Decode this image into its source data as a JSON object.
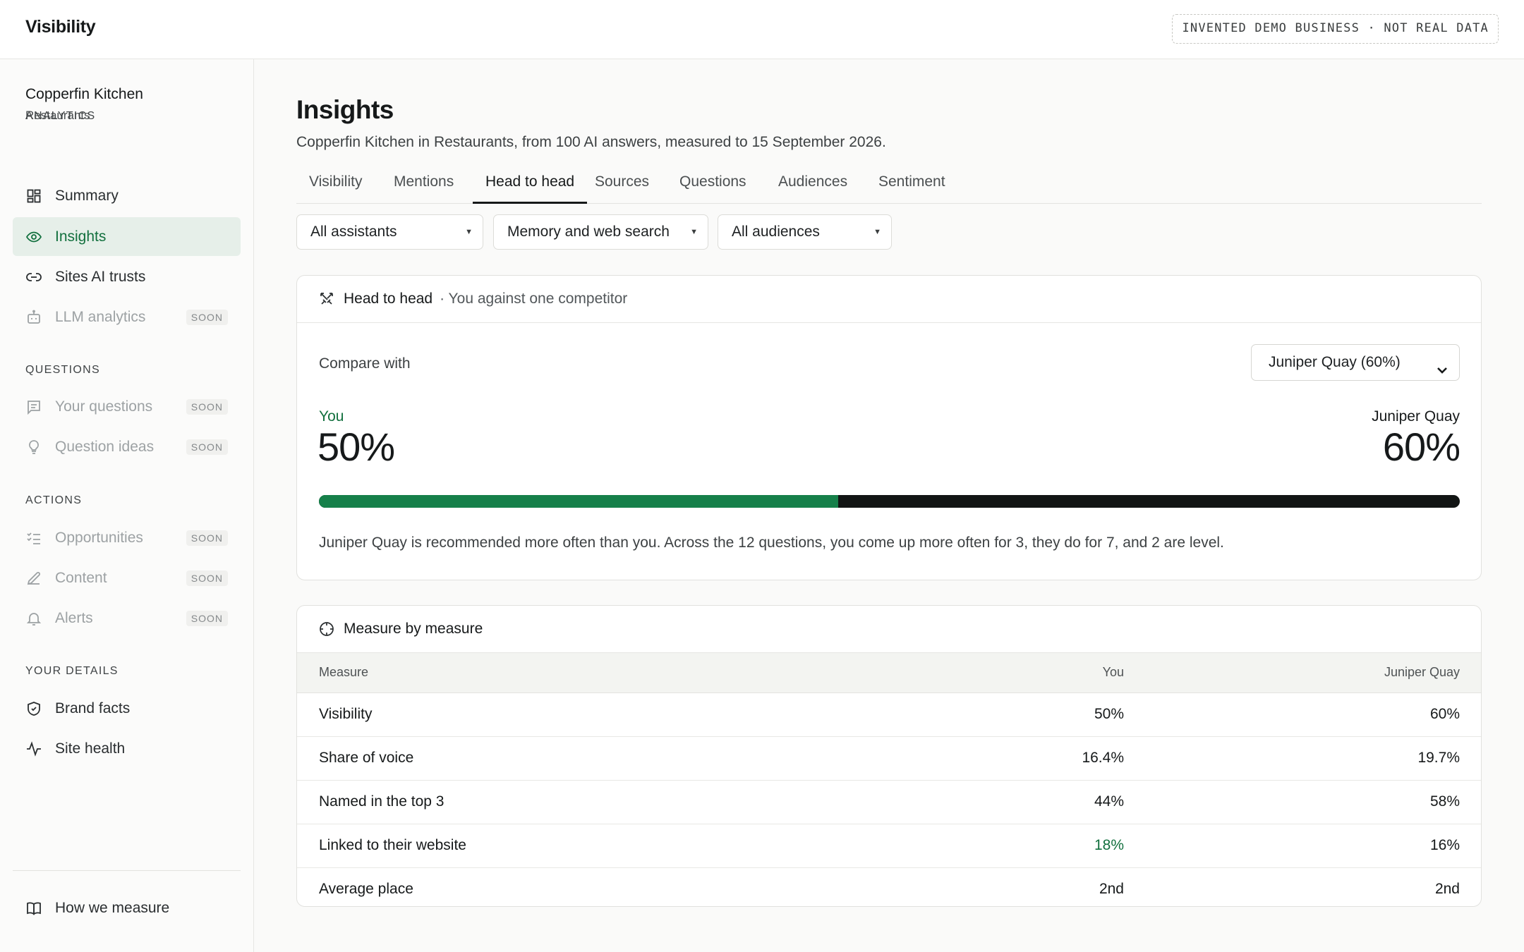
{
  "app": {
    "title": "Visibility",
    "badge": "INVENTED DEMO BUSINESS · NOT REAL DATA"
  },
  "business": {
    "name": "Copperfin Kitchen",
    "category": "Restaurants"
  },
  "sidebar": {
    "sections": [
      {
        "label": "ANALYTICS",
        "items": [
          {
            "label": "Summary",
            "icon": "grid-icon",
            "state": "normal"
          },
          {
            "label": "Insights",
            "icon": "eye-icon",
            "state": "active"
          },
          {
            "label": "Sites AI trusts",
            "icon": "link-icon",
            "state": "normal"
          },
          {
            "label": "LLM analytics",
            "icon": "bot-icon",
            "state": "soon"
          }
        ]
      },
      {
        "label": "QUESTIONS",
        "items": [
          {
            "label": "Your questions",
            "icon": "message-icon",
            "state": "soon"
          },
          {
            "label": "Question ideas",
            "icon": "lightbulb-icon",
            "state": "soon"
          }
        ]
      },
      {
        "label": "ACTIONS",
        "items": [
          {
            "label": "Opportunities",
            "icon": "checklist-icon",
            "state": "soon"
          },
          {
            "label": "Content",
            "icon": "pen-icon",
            "state": "soon"
          },
          {
            "label": "Alerts",
            "icon": "bell-icon",
            "state": "soon"
          }
        ]
      },
      {
        "label": "YOUR DETAILS",
        "items": [
          {
            "label": "Brand facts",
            "icon": "shield-icon",
            "state": "normal"
          },
          {
            "label": "Site health",
            "icon": "activity-icon",
            "state": "normal"
          }
        ]
      }
    ],
    "soon_label": "SOON",
    "footer": {
      "label": "How we measure",
      "icon": "book-icon"
    }
  },
  "page": {
    "title": "Insights",
    "subtitle": "Copperfin Kitchen in Restaurants, from 100 AI answers, measured to 15 September 2026."
  },
  "tabs": [
    {
      "label": "Visibility",
      "active": false
    },
    {
      "label": "Mentions",
      "active": false
    },
    {
      "label": "Head to head",
      "active": true
    },
    {
      "label": "Sources",
      "active": false
    },
    {
      "label": "Questions",
      "active": false
    },
    {
      "label": "Audiences",
      "active": false
    },
    {
      "label": "Sentiment",
      "active": false
    }
  ],
  "filters": {
    "assistants": "All assistants",
    "mode": "Memory and web search",
    "audiences": "All audiences"
  },
  "head_to_head": {
    "title": "Head to head",
    "subtitle": "· You against one competitor",
    "compare_label": "Compare with",
    "compare_value": "Juniper Quay (60%)",
    "you_label": "You",
    "you_value": "50%",
    "competitor_label": "Juniper Quay",
    "competitor_value": "60%",
    "you_share": 0.455,
    "summary": "Juniper Quay is recommended more often than you. Across the 12 questions, you come up more often for 3, they do for 7, and 2 are level."
  },
  "measures": {
    "title": "Measure by measure",
    "headers": {
      "measure": "Measure",
      "you": "You",
      "competitor": "Juniper Quay"
    },
    "rows": [
      {
        "measure": "Visibility",
        "you": "50%",
        "competitor": "60%",
        "you_better": false
      },
      {
        "measure": "Share of voice",
        "you": "16.4%",
        "competitor": "19.7%",
        "you_better": false
      },
      {
        "measure": "Named in the top 3",
        "you": "44%",
        "competitor": "58%",
        "you_better": false
      },
      {
        "measure": "Linked to their website",
        "you": "18%",
        "competitor": "16%",
        "you_better": true
      },
      {
        "measure": "Average place",
        "you": "2nd",
        "competitor": "2nd",
        "you_better": false
      }
    ]
  },
  "colors": {
    "accent": "#12703e",
    "bar_you": "#16804a",
    "bar_competitor": "#121514",
    "active_bg": "#e6efe9"
  }
}
